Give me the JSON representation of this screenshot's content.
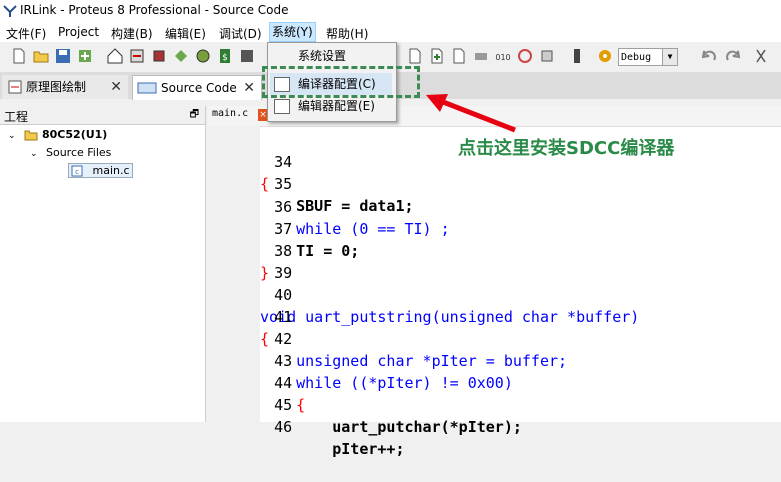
{
  "window": {
    "title": "IRLink - Proteus 8 Professional - Source Code"
  },
  "menu": {
    "items": [
      "文件(F)",
      "Project",
      "构建(B)",
      "编辑(E)",
      "调试(D)",
      "系统(Y)",
      "帮助(H)"
    ],
    "open_menu": "系统(Y)",
    "dropdown": [
      "系统设置",
      "编译器配置(C)",
      "编辑器配置(E)"
    ]
  },
  "toolbar": {
    "config_value": "Debug"
  },
  "tabs": [
    {
      "label": "原理图绘制"
    },
    {
      "label": "Source Code"
    }
  ],
  "project_panel": {
    "title": "工程",
    "tree": [
      "80C52(U1)",
      "Source Files",
      "main.c"
    ]
  },
  "editor": {
    "file_tab": "main.c",
    "lines": [
      {
        "num": "34",
        "text": "{"
      },
      {
        "num": "35",
        "text": "    SBUF = data1;"
      },
      {
        "num": "36",
        "text": "    while (0 == TI) ;"
      },
      {
        "num": "37",
        "text": "    TI = 0;"
      },
      {
        "num": "38",
        "text": "}"
      },
      {
        "num": "39",
        "text": ""
      },
      {
        "num": "40",
        "text": "void uart_putstring(unsigned char *buffer)"
      },
      {
        "num": "41",
        "text": "{"
      },
      {
        "num": "42",
        "text": "    unsigned char *pIter = buffer;"
      },
      {
        "num": "43",
        "text": "    while ((*pIter) != 0x00)"
      },
      {
        "num": "44",
        "text": "    {"
      },
      {
        "num": "45",
        "text": "        uart_putchar(*pIter);"
      },
      {
        "num": "46",
        "text": "        pIter++;"
      }
    ]
  },
  "annotation": {
    "text": "点击这里安装SDCC编译器",
    "color": "#2a8a48"
  }
}
